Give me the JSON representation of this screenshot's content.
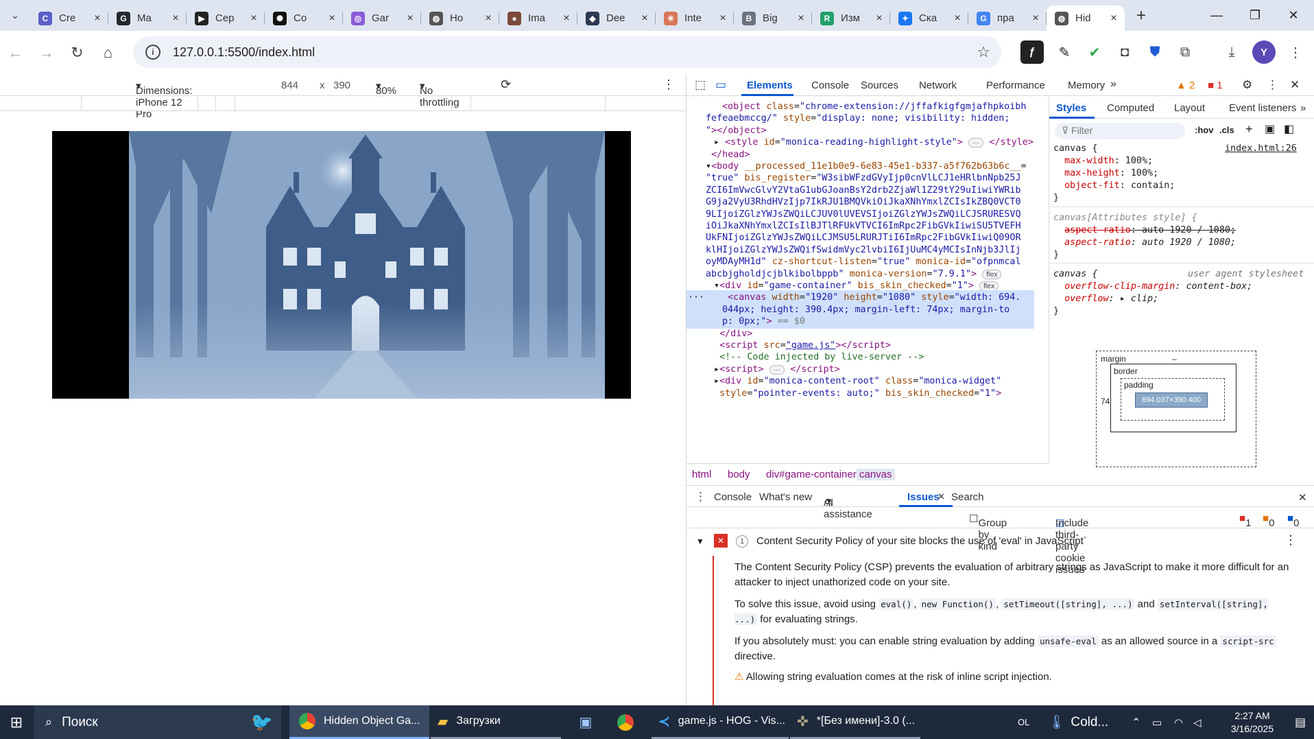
{
  "browser": {
    "tabs": [
      {
        "label": "Cre",
        "icon": "copilot-icon",
        "color": "#5b5fc7",
        "glyph": "C"
      },
      {
        "label": "Ma",
        "icon": "github-icon",
        "color": "#24292f",
        "glyph": "G"
      },
      {
        "label": "Сер",
        "icon": "clapperboard-icon",
        "color": "#222222",
        "glyph": "▶"
      },
      {
        "label": "Co",
        "icon": "openai-icon",
        "color": "#111111",
        "glyph": "✺"
      },
      {
        "label": "Gar",
        "icon": "spiral-icon",
        "color": "#8a5cd8",
        "glyph": "◎"
      },
      {
        "label": "Ho",
        "icon": "globe-icon",
        "color": "#555555",
        "glyph": "◍"
      },
      {
        "label": "Ima",
        "icon": "avatar-icon",
        "color": "#7a4a3a",
        "glyph": "●"
      },
      {
        "label": "Dee",
        "icon": "deepseek-icon",
        "color": "#2d3a55",
        "glyph": "◆"
      },
      {
        "label": "Inte",
        "icon": "claude-icon",
        "color": "#d97757",
        "glyph": "✳"
      },
      {
        "label": "Big",
        "icon": "bing-icon",
        "color": "#6b7280",
        "glyph": "B"
      },
      {
        "label": "Изм",
        "icon": "rp-icon",
        "color": "#22a06b",
        "glyph": "R"
      },
      {
        "label": "Ска",
        "icon": "butterfly-icon",
        "color": "#1877f2",
        "glyph": "✦"
      },
      {
        "label": "пра",
        "icon": "google-icon",
        "color": "#4285f4",
        "glyph": "G"
      },
      {
        "label": "Hid",
        "icon": "globe-icon",
        "color": "#555555",
        "glyph": "◍",
        "active": true
      }
    ],
    "url": "127.0.0.1:5500/index.html",
    "profile_initial": "Y"
  },
  "device_toolbar": {
    "dimensions_label": "Dimensions: iPhone 12 Pro",
    "width": "844",
    "times": "x",
    "height": "390",
    "zoom": "80%",
    "throttling": "No throttling"
  },
  "devtools": {
    "tabs": [
      "Elements",
      "Console",
      "Sources",
      "Network",
      "Performance",
      "Memory"
    ],
    "active_tab": "Elements",
    "warnings_count": "2",
    "errors_count": "1",
    "dom_lines": [
      {
        "indent": 2,
        "html": "<span class=\"tag\">&lt;object</span> <span class=\"attr\">class</span>=<span class=\"val\">\"chrome-extension://jffafkigfgmjafhpkoibh</span>"
      },
      {
        "indent": 0,
        "html": "<span class=\"val\">fefeaebmccg/\"</span> <span class=\"attr\">style</span>=<span class=\"val\">\"display: none; visibility: hidden;</span>"
      },
      {
        "indent": 0,
        "html": "<span class=\"val\">\"</span><span class=\"tag\">&gt;&lt;/object&gt;</span>"
      },
      {
        "indent": 1,
        "html": "▸ <span class=\"tag\">&lt;style</span> <span class=\"attr\">id</span>=<span class=\"val\">\"monica-reading-highlight-style\"</span><span class=\"tag\">&gt;</span> <span class=\"badge\">···</span> <span class=\"tag\">&lt;/style&gt;</span>"
      },
      {
        "indent": 0,
        "html": " <span class=\"tag\">&lt;/head&gt;</span>"
      },
      {
        "indent": 0,
        "html": "▾<span class=\"tag\">&lt;body</span> <span class=\"attr\">__processed_11e1b0e9-6e83-45e1-b337-a5f762b63b6c__</span>="
      },
      {
        "indent": 0,
        "html": "<span class=\"val\">\"true\"</span> <span class=\"attr\">bis_register</span>=<span class=\"val\">\"W3sibWFzdGVyIjp0cnVlLCJ1eHRlbnNpb25J</span>"
      },
      {
        "indent": 0,
        "html": "<span class=\"val\">ZCI6ImVwcGlvY2VtaG1ubGJoanBsY2drb2ZjaWl1Z29tY29uIiwiYWRib</span>"
      },
      {
        "indent": 0,
        "html": "<span class=\"val\">G9ja2VyU3RhdHVzIjp7IkRJU1BMQVkiOiJkaXNhYmxlZCIsIkZBQ0VCT0</span>"
      },
      {
        "indent": 0,
        "html": "<span class=\"val\">9LIjoiZGlzYWJsZWQiLCJUV0lUVEVSIjoiZGlzYWJsZWQiLCJSRURESVQ</span>"
      },
      {
        "indent": 0,
        "html": "<span class=\"val\">iOiJkaXNhYmxlZCIsIlBJTlRFUkVTVCI6ImRpc2FibGVkIiwiSU5TVEFH</span>"
      },
      {
        "indent": 0,
        "html": "<span class=\"val\">UkFNIjoiZGlzYWJsZWQiLCJMSU5LRURJTiI6ImRpc2FibGVkIiwiQ09OR</span>"
      },
      {
        "indent": 0,
        "html": "<span class=\"val\">klHIjoiZGlzYWJsZWQifSwidmVyc2lvbiI6IjUuMC4yMCIsInNjb3JlIj</span>"
      },
      {
        "indent": 0,
        "html": "<span class=\"val\">oyMDAyMH1d\"</span> <span class=\"attr\">cz-shortcut-listen</span>=<span class=\"val\">\"true\"</span> <span class=\"attr\">monica-id</span>=<span class=\"val\">\"ofpnmcal</span>"
      },
      {
        "indent": 0,
        "html": "<span class=\"val\">abcbjgholdjcjblkibolbppb\"</span> <span class=\"attr\">monica-version</span>=<span class=\"val\">\"7.9.1\"</span><span class=\"tag\">&gt;</span> <span class=\"badge\">flex</span>"
      },
      {
        "indent": 1,
        "html": "▾<span class=\"tag\">&lt;div</span> <span class=\"attr\">id</span>=<span class=\"val\">\"game-container\"</span> <span class=\"attr\">bis_skin_checked</span>=<span class=\"val\">\"1\"</span><span class=\"tag\">&gt;</span> <span class=\"badge\">flex</span>"
      },
      {
        "indent": 2,
        "html": " <span class=\"tag\">&lt;canvas</span> <span class=\"attr\">width</span>=<span class=\"val\">\"1920\"</span> <span class=\"attr\">height</span>=<span class=\"val\">\"1080\"</span> <span class=\"attr\">style</span>=<span class=\"val\">\"width: 694.</span>",
        "selected": true
      },
      {
        "indent": 2,
        "html": "<span class=\"val\">044px; height: 390.4px; margin-left: 74px; margin-to</span>",
        "selected": true
      },
      {
        "indent": 2,
        "html": "<span class=\"val\">p: 0px;\"</span><span class=\"tag\">&gt;</span> <span style=\"color:#777\">== $0</span>",
        "selected": true
      },
      {
        "indent": 1,
        "html": " <span class=\"tag\">&lt;/div&gt;</span>"
      },
      {
        "indent": 1,
        "html": " <span class=\"tag\">&lt;script</span> <span class=\"attr\">src</span>=<span class=\"val\" style=\"text-decoration:underline\">\"game.js\"</span><span class=\"tag\">&gt;&lt;/script&gt;</span>"
      },
      {
        "indent": 1,
        "html": " <span class=\"cmt\">&lt;!-- Code injected by live-server --&gt;</span>"
      },
      {
        "indent": 1,
        "html": "▸<span class=\"tag\">&lt;script&gt;</span> <span class=\"badge\">···</span> <span class=\"tag\">&lt;/script&gt;</span>"
      },
      {
        "indent": 1,
        "html": "▸<span class=\"tag\">&lt;div</span> <span class=\"attr\">id</span>=<span class=\"val\">\"monica-content-root\"</span> <span class=\"attr\">class</span>=<span class=\"val\">\"monica-widget\"</span>"
      },
      {
        "indent": 1,
        "html": " <span class=\"attr\">style</span>=<span class=\"val\">\"pointer-events: auto;\"</span> <span class=\"attr\">bis_skin_checked</span>=<span class=\"val\">\"1\"</span><span class=\"tag\">&gt;</span>"
      }
    ],
    "breadcrumbs": [
      "html",
      "body",
      "div#game-container",
      "canvas"
    ],
    "styles_tabs": [
      "Styles",
      "Computed",
      "Layout",
      "Event listeners"
    ],
    "filter_placeholder": "Filter",
    "hov": ":hov",
    "cls": ".cls",
    "rule1_source": "index.html:26",
    "rule1_html": "<span class=\"tag\" style=\"color:#1f1f1f\">canvas {</span><br>&nbsp;&nbsp;<span style=\"color:#c80000\">max-width</span>: 100%;<br>&nbsp;&nbsp;<span style=\"color:#c80000\">max-height</span>: 100%;<br>&nbsp;&nbsp;<span style=\"color:#c80000\">object-fit</span>: contain;<br>}",
    "rule2_html": "<i style=\"color:#888\">canvas[Attributes style] {</i><br>&nbsp;&nbsp;<s style=\"color:#c80000\">aspect-ratio</s><s>: auto 1920 / 1080;</s><br>&nbsp;&nbsp;<i><span style=\"color:#c80000\">aspect-ratio</span>: auto 1920 / 1080;</i><br>}",
    "rule3_source": "user agent stylesheet",
    "rule3_html": "<i>canvas {</i><br>&nbsp;&nbsp;<i><span style=\"color:#c80000\">overflow-clip-margin</span>: content-box;</i><br>&nbsp;&nbsp;<i><span style=\"color:#c80000\">overflow</span>: ▸ clip;</i><br>}",
    "box_model": {
      "margin_label": "margin",
      "border_label": "border",
      "padding_label": "padding",
      "content": "694.037×390.400",
      "margin_left": "74",
      "dash": "–"
    },
    "drawer_tabs": [
      "Console",
      "What's new",
      "AI assistance",
      "Issues",
      "Search"
    ],
    "group_by_kind": "Group by kind",
    "include_third_party": "Include third-party cookie issues",
    "issue_counts": {
      "errors": "1",
      "warnings": "0",
      "info": "0"
    },
    "issue": {
      "count": "1",
      "title": "Content Security Policy of your site blocks the use of 'eval' in JavaScript`",
      "p1": "The Content Security Policy (CSP) prevents the evaluation of arbitrary strings as JavaScript to make it more difficult for an attacker to inject unathorized code on your site.",
      "p2_html": "To solve this issue, avoid using <code>eval()</code>, <code>new Function()</code>, <code>setTimeout([string], ...)</code> and <code>setInterval([string], ...)</code> for evaluating strings.",
      "p3_html": "If you absolutely must: you can enable string evaluation by adding <code>unsafe-eval</code> as an allowed source in a <code>script-src</code> directive.",
      "warning": "Allowing string evaluation comes at the risk of inline script injection."
    }
  },
  "taskbar": {
    "search": "Поиск",
    "apps": [
      {
        "label": "Hidden Object Ga...",
        "icon": "chrome-icon"
      },
      {
        "label": "Загрузки",
        "icon": "folder-icon"
      },
      {
        "label": "",
        "icon": "monitor-icon"
      },
      {
        "label": "",
        "icon": "chrome-icon"
      },
      {
        "label": "game.js - HOG - Vis...",
        "icon": "vscode-icon"
      },
      {
        "label": "*[Без имени]-3.0 (...",
        "icon": "gimp-icon"
      }
    ],
    "layout": "OL",
    "weather": "Cold...",
    "time": "2:27 AM",
    "date": "3/16/2025"
  }
}
